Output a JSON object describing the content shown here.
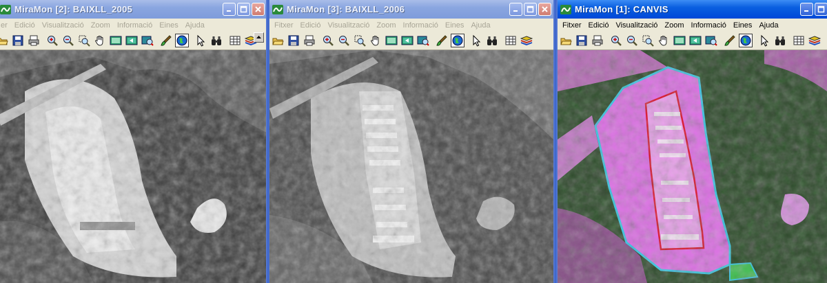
{
  "windows": [
    {
      "title": "MiraMon [2]:  BAIXLL_2005",
      "active": false,
      "menu": [
        "er",
        "Edició",
        "Visualització",
        "Zoom",
        "Informació",
        "Eines",
        "Ajuda"
      ]
    },
    {
      "title": "MiraMon [3]:  BAIXLL_2006",
      "active": false,
      "menu": [
        "Fitxer",
        "Edició",
        "Visualització",
        "Zoom",
        "Informació",
        "Eines",
        "Ajuda"
      ]
    },
    {
      "title": "MiraMon [1]:  CANVIS",
      "active": true,
      "menu": [
        "Fitxer",
        "Edició",
        "Visualització",
        "Zoom",
        "Informació",
        "Eines",
        "Ajuda"
      ]
    }
  ],
  "toolbar_tools": [
    "open-folder-icon",
    "save-icon",
    "print-icon",
    "zoom-in-icon",
    "zoom-out-icon",
    "zoom-window-icon",
    "pan-hand-icon",
    "full-view-icon",
    "previous-view-icon",
    "zoom-layer-icon",
    "paint-brush-icon",
    "globe-icon",
    "pointer-icon",
    "binoculars-icon",
    "table-icon",
    "layers-icon"
  ],
  "colors": {
    "active_title": "#0a5fe0",
    "inactive_title": "#8aa6e0",
    "change_outline_red": "#e0102a",
    "change_outline_cyan": "#39c8e8",
    "change_fill_magenta": "#e070e8"
  }
}
